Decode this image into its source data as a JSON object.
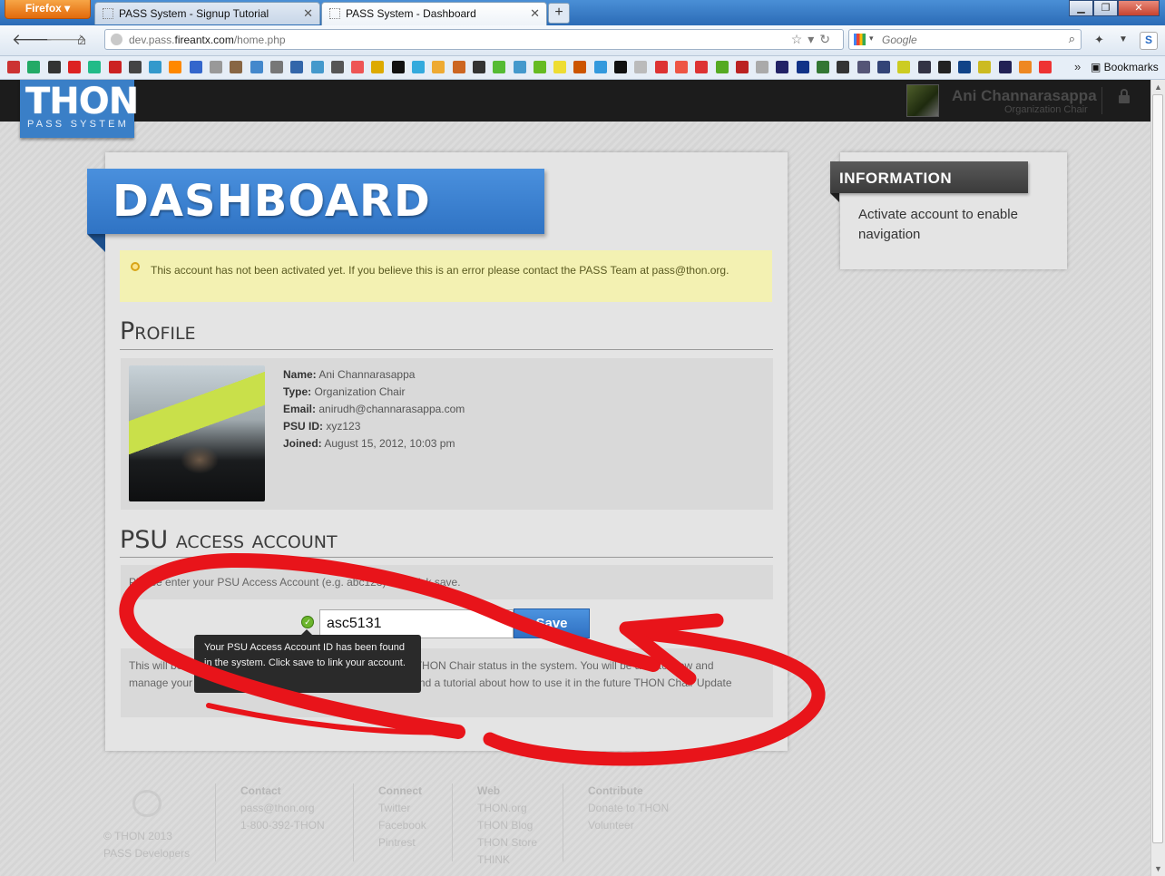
{
  "browser": {
    "menu_button": "Firefox",
    "tabs": [
      {
        "label": "PASS System - Signup Tutorial"
      },
      {
        "label": "PASS System - Dashboard"
      }
    ],
    "url_host": "dev.pass.",
    "url_domain": "fireantx.com",
    "url_path": "/home.php",
    "search_placeholder": "Google",
    "bookmarks_label": "Bookmarks"
  },
  "header": {
    "logo_top": "THON",
    "logo_bottom": "PASS SYSTEM",
    "user_name": "Ani Channarasappa",
    "user_role": "Organization Chair"
  },
  "main": {
    "title": "DASHBOARD",
    "alert": "This account has not been activated yet. If you believe this is an error please contact the PASS Team at pass@thon.org.",
    "profile_heading": "Profile",
    "profile": {
      "name_label": "Name:",
      "name": " Ani Channarasappa",
      "type_label": "Type:",
      "type": " Organization Chair",
      "email_label": "Email:",
      "email": " anirudh@channarasappa.com",
      "psuid_label": "PSU ID:",
      "psuid": " xyz123",
      "joined_label": "Joined:",
      "joined": " August 15, 2012, 10:03 pm"
    },
    "account_heading": "PSU access account",
    "account_instructions": "Please enter your PSU Access Account (e.g. abc123) and click save.",
    "account_value": "asc5131",
    "save_label": "Save",
    "tooltip": "Your PSU Access Account ID has been found in the system. Click save to link your account.",
    "info_text": "This will be used to pull information on THON to verify your THON Chair status in the system. You will be able to view and manage your list during THON weekend. More information and a tutorial about how to use it in the future THON Chair Update"
  },
  "sidebar": {
    "heading": "INFORMATION",
    "text": "Activate account to enable navigation"
  },
  "footer": {
    "copyright": "© THON 2013",
    "developers": "PASS Developers",
    "columns": [
      {
        "heading": "Contact",
        "items": [
          "pass@thon.org",
          "1-800-392-THON"
        ]
      },
      {
        "heading": "Connect",
        "items": [
          "Twitter",
          "Facebook",
          "Pintrest"
        ]
      },
      {
        "heading": "Web",
        "items": [
          "THON.org",
          "THON Blog",
          "THON Store",
          "THINK"
        ]
      },
      {
        "heading": "Contribute",
        "items": [
          "Donate to THON",
          "Volunteer"
        ]
      }
    ]
  },
  "colors": {
    "accent_blue": "#3a7fc7",
    "annotation_red": "#e8141a",
    "alert_yellow": "#f3f1b2"
  }
}
